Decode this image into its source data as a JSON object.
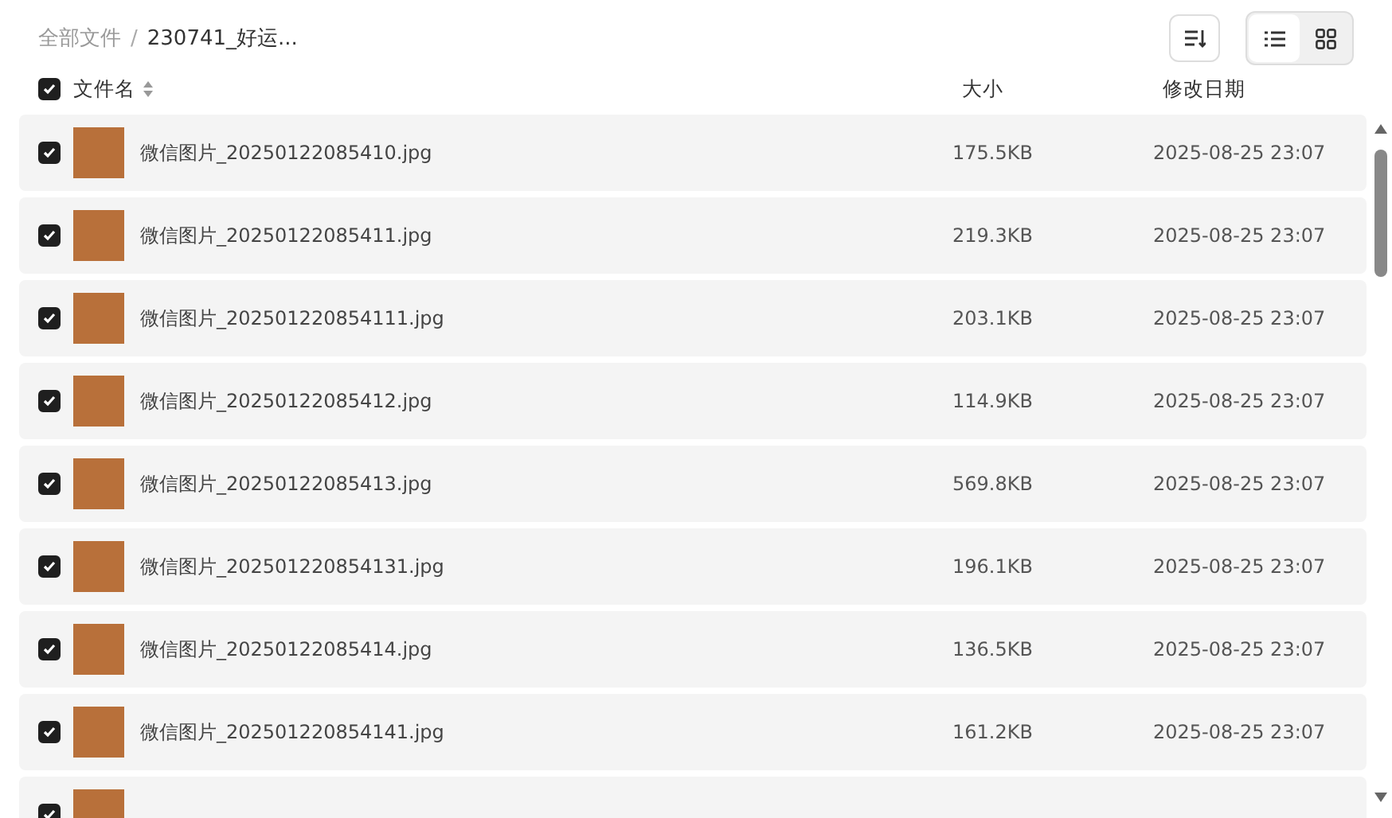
{
  "breadcrumb_separator": "/",
  "breadcrumb": [
    {
      "label": "全部文件",
      "current": false
    },
    {
      "label": "230741_好运...",
      "current": true
    }
  ],
  "view_toggle": [
    {
      "kind": "list",
      "selected": true
    },
    {
      "kind": "grid",
      "selected": false
    }
  ],
  "table": {
    "select_all": {
      "checked": true
    },
    "columns": [
      "文件名",
      "大小",
      "修改日期"
    ],
    "rows": [
      {
        "name": "微信图片_20250122085410.jpg",
        "size": "175.5KB",
        "modified": "2025-08-25 23:07",
        "checked": true
      },
      {
        "name": "微信图片_20250122085411.jpg",
        "size": "219.3KB",
        "modified": "2025-08-25 23:07",
        "checked": true
      },
      {
        "name": "微信图片_202501220854111.jpg",
        "size": "203.1KB",
        "modified": "2025-08-25 23:07",
        "checked": true
      },
      {
        "name": "微信图片_20250122085412.jpg",
        "size": "114.9KB",
        "modified": "2025-08-25 23:07",
        "checked": true
      },
      {
        "name": "微信图片_20250122085413.jpg",
        "size": "569.8KB",
        "modified": "2025-08-25 23:07",
        "checked": true
      },
      {
        "name": "微信图片_202501220854131.jpg",
        "size": "196.1KB",
        "modified": "2025-08-25 23:07",
        "checked": true
      },
      {
        "name": "微信图片_20250122085414.jpg",
        "size": "136.5KB",
        "modified": "2025-08-25 23:07",
        "checked": true
      },
      {
        "name": "微信图片_202501220854141.jpg",
        "size": "161.2KB",
        "modified": "2025-08-25 23:07",
        "checked": true
      },
      {
        "checked": true
      }
    ]
  }
}
